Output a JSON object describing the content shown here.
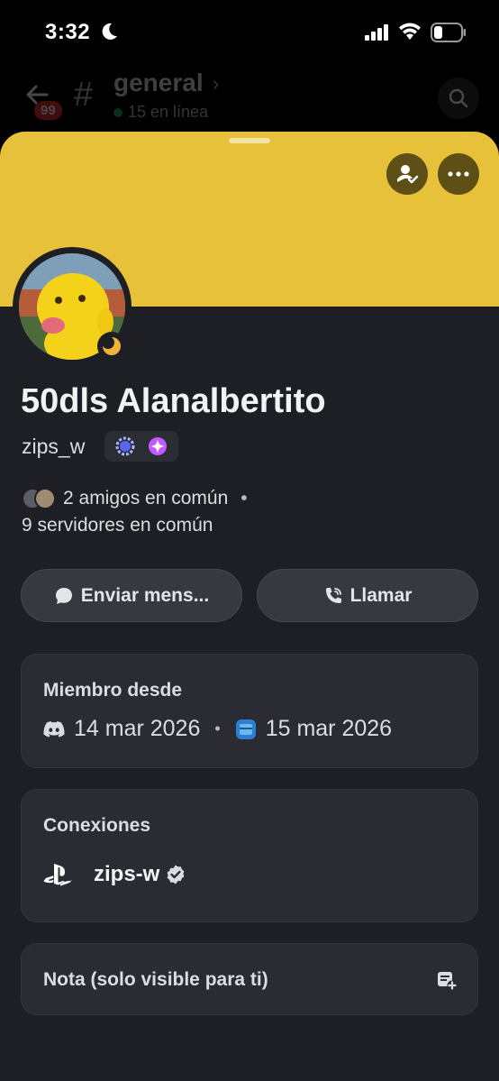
{
  "status_bar": {
    "time": "3:32"
  },
  "header": {
    "badge": "99",
    "channel_name": "general",
    "online_text": "15 en línea"
  },
  "profile": {
    "display_name": "50dls Alanalbertito",
    "username": "zips_w",
    "mutual_friends": "2 amigos en común",
    "mutual_servers": "9 servidores en común",
    "separator": "•"
  },
  "actions": {
    "message_label": "Enviar mens...",
    "call_label": "Llamar"
  },
  "member_since": {
    "title": "Miembro desde",
    "discord_date": "14 mar 2026",
    "server_date": "15 mar 2026",
    "separator": "•"
  },
  "connections": {
    "title": "Conexiones",
    "items": [
      {
        "platform_icon": "playstation-icon",
        "name": "zips-w",
        "verified": true
      }
    ]
  },
  "note": {
    "label": "Nota (solo visible para ti)"
  },
  "colors": {
    "banner": "#e8c13b",
    "sheet_bg": "#1e1f24",
    "card_bg": "#2a2b33",
    "button_bg": "#373941",
    "idle_status": "#f0b232"
  }
}
